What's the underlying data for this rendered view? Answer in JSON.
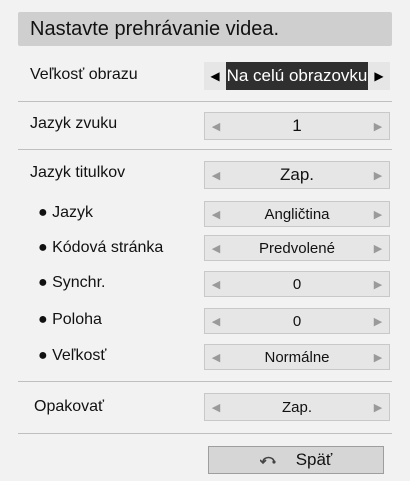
{
  "title": "Nastavte prehrávanie videa.",
  "rows": [
    {
      "label": "Veľkosť obrazu",
      "value": "Na celú obrazovku"
    },
    {
      "label": "Jazyk zvuku",
      "value": "1"
    },
    {
      "label": "Jazyk titulkov",
      "value": "Zap."
    },
    {
      "label": "● Jazyk",
      "value": "Angličtina"
    },
    {
      "label": "● Kódová stránka",
      "value": "Predvolené"
    },
    {
      "label": "● Synchr.",
      "value": "0"
    },
    {
      "label": "● Poloha",
      "value": "0"
    },
    {
      "label": "● Veľkosť",
      "value": "Normálne"
    },
    {
      "label": "Opakovať",
      "value": "Zap."
    }
  ],
  "arrows": {
    "left": "◀",
    "right": "▶"
  },
  "back": {
    "label": "Späť",
    "icon": "return-icon"
  }
}
